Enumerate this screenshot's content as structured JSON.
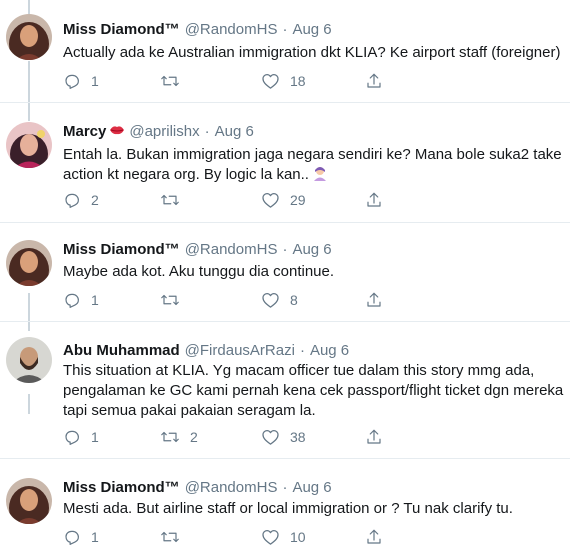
{
  "tweets": [
    {
      "name": "Miss Diamond™",
      "handle": "@RandomHS",
      "date": "Aug 6",
      "lines": [
        "Actually ada ke Australian immigration dkt KLIA? Ke airport staff (foreigner)"
      ],
      "reply_count": "1",
      "retweet_count": "",
      "like_count": "18"
    },
    {
      "name": "Marcy",
      "handle": "@aprilishx",
      "date": "Aug 6",
      "lines": [
        "Entah la. Bukan immigration jaga negara sendiri ke? Mana bole suka2 take",
        "action kt negara org. By logic la kan.."
      ],
      "reply_count": "2",
      "retweet_count": "",
      "like_count": "29"
    },
    {
      "name": "Miss Diamond™",
      "handle": "@RandomHS",
      "date": "Aug 6",
      "lines": [
        "Maybe ada kot. Aku tunggu dia continue."
      ],
      "reply_count": "1",
      "retweet_count": "",
      "like_count": "8"
    },
    {
      "name": "Abu Muhammad",
      "handle": "@FirdausArRazi",
      "date": "Aug 6",
      "lines": [
        "This situation at KLIA. Yg macam officer tue dalam this story mmg ada,",
        "pengalaman  ke GC kami pernah kena cek passport/flight ticket dgn mereka",
        "tapi semua pakai pakaian seragam la."
      ],
      "reply_count": "1",
      "retweet_count": "2",
      "like_count": "38"
    },
    {
      "name": "Miss Diamond™",
      "handle": "@RandomHS",
      "date": "Aug 6",
      "lines": [
        "Mesti ada. But airline staff or local immigration or ? Tu nak clarify tu."
      ],
      "reply_count": "1",
      "retweet_count": "",
      "like_count": "10"
    }
  ],
  "icons": {
    "reply": "reply-icon",
    "retweet": "retweet-icon",
    "like": "heart-icon",
    "share": "share-icon",
    "name_emoji": "lips-emoji",
    "text_emoji": "woman-tipping-hand-emoji"
  },
  "colors": {
    "text": "#14171a",
    "secondary": "#657786",
    "divider": "#e6ecf0",
    "thread": "#ccd6dd"
  }
}
